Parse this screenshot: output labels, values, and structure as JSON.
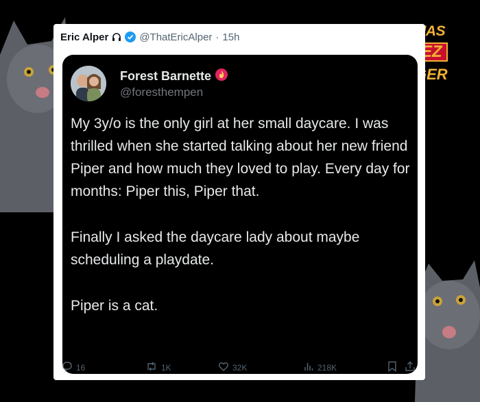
{
  "outer_tweet": {
    "author_name": "Eric Alper",
    "handle": "@ThatEricAlper",
    "separator": "·",
    "time": "15h"
  },
  "quoted_tweet": {
    "author_name": "Forest Barnette",
    "handle": "@foresthempen",
    "paragraphs": [
      "My 3y/o is the only girl at her small daycare. I was thrilled when she started talking about her new friend Piper and how much they loved to play. Every day for months: Piper this, Piper that.",
      "Finally I asked the daycare lady about maybe scheduling a playdate.",
      "Piper is a cat."
    ]
  },
  "actions": {
    "replies": "16",
    "reposts": "1K",
    "likes": "32K",
    "views": "218K"
  },
  "logo": {
    "line1": "ICANHAS",
    "line2": "CHEEZ",
    "line3": "BURGER"
  },
  "colors": {
    "verified": "#1d9bf0",
    "logo_gold": "#f2b233",
    "logo_red": "#c8102e"
  }
}
